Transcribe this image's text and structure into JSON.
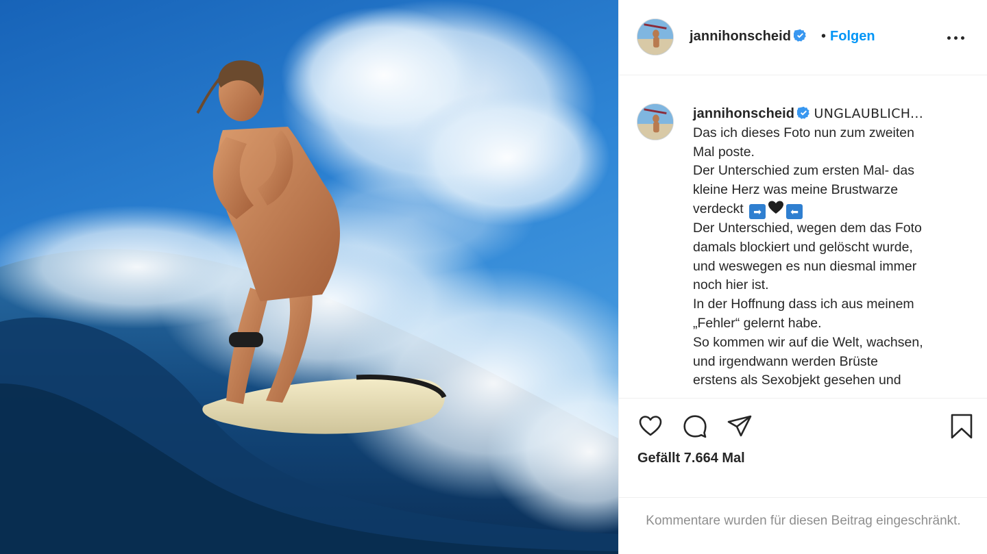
{
  "post": {
    "username": "jannihonscheid",
    "follow_label": "Folgen",
    "dot": "•",
    "more_icon": "more-horizontal-icon",
    "verified_icon": "verified-badge-icon"
  },
  "caption": {
    "username": "jannihonscheid",
    "lines": [
      "UNGLAUBLICH...",
      "Das ich dieses Foto nun zum zweiten",
      "Mal poste.",
      "Der Unterschied zum ersten Mal- das",
      "kleine Herz was meine Brustwarze",
      "verdeckt",
      "Der Unterschied, wegen dem das Foto",
      "damals blockiert und gelöscht wurde,",
      "und weswegen es nun diesmal immer",
      "noch hier ist.",
      "In der Hoffnung dass ich aus meinem",
      "„Fehler“ gelernt habe.",
      "So kommen wir auf die Welt, wachsen,",
      "und irgendwann werden Brüste",
      "erstens als Sexobjekt gesehen und"
    ],
    "emoji_right_arrow": "➡",
    "emoji_left_arrow": "⬅"
  },
  "actions": {
    "like_icon": "heart-icon",
    "comment_icon": "comment-bubble-icon",
    "share_icon": "paper-plane-icon",
    "bookmark_icon": "bookmark-icon",
    "likes_text": "Gefällt 7.664 Mal"
  },
  "comments": {
    "restricted_text": "Kommentare wurden für diesen Beitrag eingeschränkt."
  },
  "colors": {
    "accent": "#0095f6",
    "verified": "#3897f0",
    "text": "#262626",
    "muted": "#8e8e8e",
    "divider": "#efefef"
  }
}
